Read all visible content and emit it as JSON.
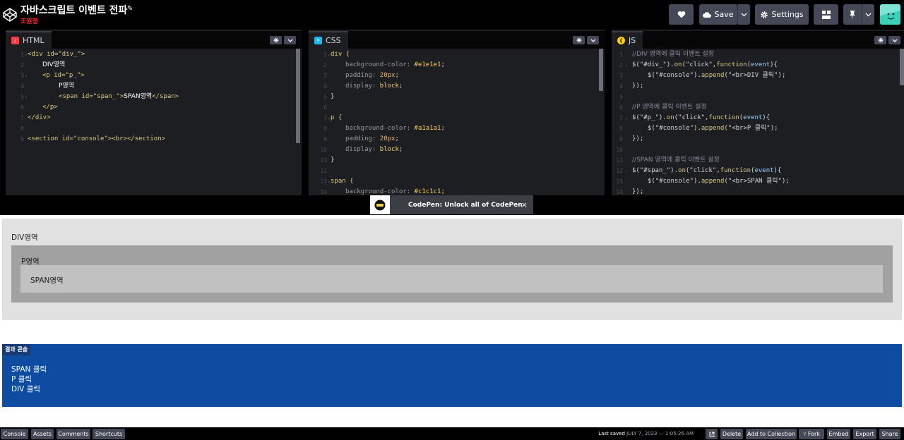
{
  "header": {
    "title": "자바스크립트 이벤트 전파",
    "author": "조원정",
    "save_label": "Save",
    "settings_label": "Settings"
  },
  "editors": {
    "html": {
      "label": "HTML",
      "badge_color": "#ff3c41",
      "lines": [
        {
          "n": "1",
          "fold": true
        },
        {
          "n": "2"
        },
        {
          "n": "3",
          "fold": true
        },
        {
          "n": "4"
        },
        {
          "n": "5",
          "fold": true
        },
        {
          "n": "6"
        },
        {
          "n": "7"
        },
        {
          "n": "8"
        },
        {
          "n": "9"
        }
      ],
      "code": {
        "l1": "<div id=\"div_\">",
        "l2": "DIV영역",
        "l3": "<p id=\"p_\">",
        "l4": "P영역",
        "l5_open": "<span id=\"span_\">",
        "l5_text": "SPAN영역",
        "l5_close": "</span>",
        "l6": "</p>",
        "l7": "</div>",
        "l9": "<section id=\"console\"><br></section>"
      }
    },
    "css": {
      "label": "CSS",
      "badge_color": "#0ebeff",
      "code": {
        "l1": "div {",
        "l2_prop": "background-color: ",
        "l2_val": "#e1e1e1",
        "l3_prop": "padding: ",
        "l3_val": "20px",
        "l4_prop": "display: ",
        "l4_val": "block",
        "l5": "}",
        "l7": "p {",
        "l8_prop": "background-color: ",
        "l8_val": "#a1a1a1",
        "l9_prop": "padding: ",
        "l9_val": "20px",
        "l10_prop": "display: ",
        "l10_val": "block",
        "l11": "}",
        "l13": "span {",
        "l14_prop": "background-color: ",
        "l14_val": "#c1c1c1;"
      }
    },
    "js": {
      "label": "JS",
      "badge_color": "#fcd000",
      "code": {
        "l1": "//DIV 영역에 클릭 이벤트 설정",
        "l2a": "$(\"#div_\").",
        "l2b": "on",
        "l2c": "(\"click\",",
        "l2d": "function",
        "l2e": "(",
        "l2f": "event",
        "l2g": "){",
        "l3a": "$(\"#console\").",
        "l3b": "append",
        "l3c": "(\"<br>DIV 클릭\");",
        "l4": "});",
        "l6": "//P 영역에 클릭 이벤트 설정",
        "l7a": "$(\"#p_\").",
        "l7b": "on",
        "l7c": "(\"click\",",
        "l7d": "function",
        "l7e": "(",
        "l7f": "event",
        "l7g": "){",
        "l8a": "$(\"#console\").",
        "l8b": "append",
        "l8c": "(\"<br>P 클릭\");",
        "l9": "});",
        "l11": "//SPAN 영역에 클릭 이벤트 설정",
        "l12a": "$(\"#span_\").",
        "l12b": "on",
        "l12c": "(\"click\",",
        "l12d": "function",
        "l12e": "(",
        "l12f": "event",
        "l12g": "){",
        "l13a": "$(\"#console\").",
        "l13b": "append",
        "l13c": "(\"<br>SPAN 클릭\");",
        "l14": "});"
      }
    }
  },
  "notification": {
    "text": "CodePen: Unlock all of CodePen",
    "close": "×"
  },
  "preview": {
    "div_label": "DIV영역",
    "p_label": "P영역",
    "span_label": "SPAN영역",
    "console_title": "결과 콘솔",
    "console_lines": [
      "SPAN 클릭",
      "P 클릭",
      "DIV 클릭"
    ]
  },
  "footer": {
    "console": "Console",
    "assets": "Assets",
    "comments": "Comments",
    "shortcuts": "Shortcuts",
    "last_saved_label": "Last saved",
    "last_saved_date": "JULY 7, 2023 — 1:05:26 AM",
    "delete": "Delete",
    "add_to_collection": "Add to Collection",
    "fork": "Fork",
    "embed": "Embed",
    "export": "Export",
    "share": "Share"
  },
  "colors": {
    "div_bg": "#e1e1e1",
    "p_bg": "#a1a1a1",
    "span_bg": "#c1c1c1",
    "console_bg": "#0d4ca0"
  }
}
